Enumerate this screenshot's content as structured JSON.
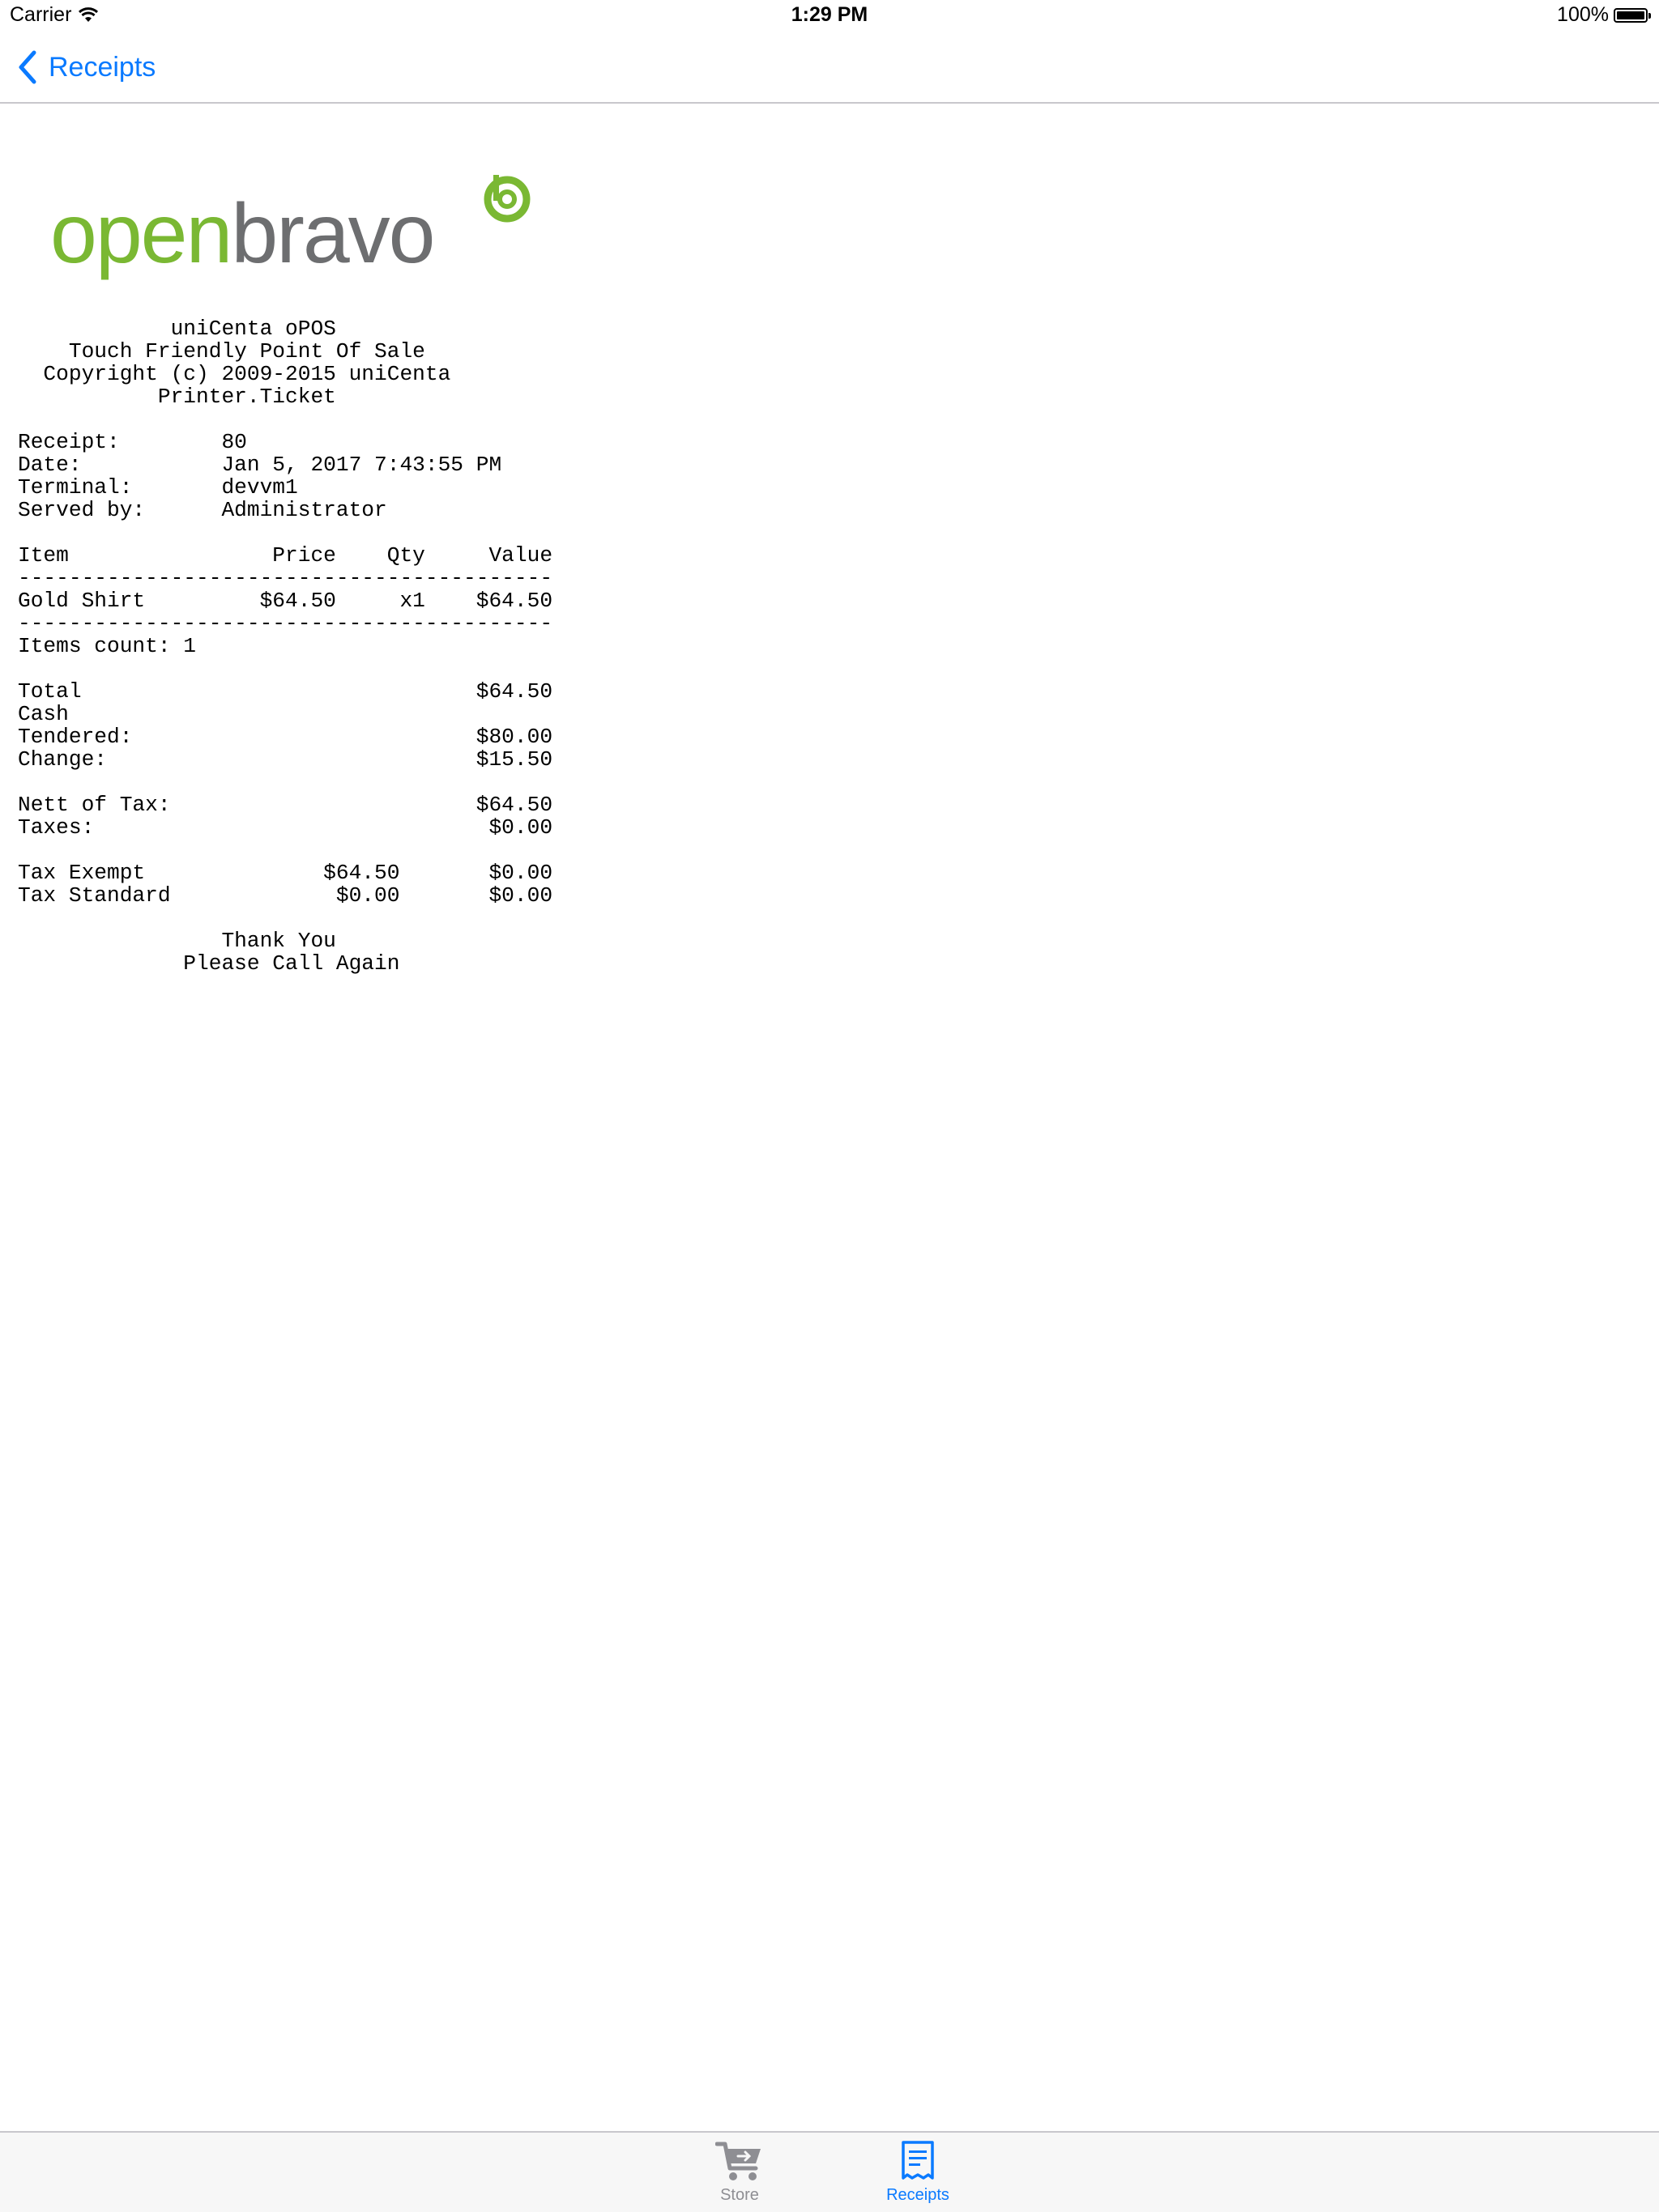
{
  "status_bar": {
    "carrier": "Carrier",
    "time": "1:29 PM",
    "battery": "100%"
  },
  "nav": {
    "back_label": "Receipts",
    "back_icon": "chevron-left-icon",
    "accent": "#0a7aff"
  },
  "receipt": {
    "logo": {
      "brand_text": "openbravo",
      "green": "#7ab833",
      "gray": "#6d6e70"
    },
    "lines": [
      "            uniCenta oPOS",
      "    Touch Friendly Point Of Sale",
      "  Copyright (c) 2009-2015 uniCenta",
      "           Printer.Ticket",
      "",
      "Receipt:        80",
      "Date:           Jan 5, 2017 7:43:55 PM",
      "Terminal:       devvm1",
      "Served by:      Administrator",
      "",
      "Item                Price    Qty     Value",
      "------------------------------------------",
      "Gold Shirt         $64.50     x1    $64.50",
      "------------------------------------------",
      "Items count: 1",
      "",
      "Total                               $64.50",
      "Cash",
      "Tendered:                           $80.00",
      "Change:                             $15.50",
      "",
      "Nett of Tax:                        $64.50",
      "Taxes:                               $0.00",
      "",
      "Tax Exempt              $64.50       $0.00",
      "Tax Standard             $0.00       $0.00",
      "",
      "                Thank You",
      "             Please Call Again"
    ]
  },
  "tab_bar": {
    "tabs": [
      {
        "label": "Store",
        "icon": "cart-icon",
        "selected": false
      },
      {
        "label": "Receipts",
        "icon": "receipt-icon",
        "selected": true
      }
    ]
  }
}
